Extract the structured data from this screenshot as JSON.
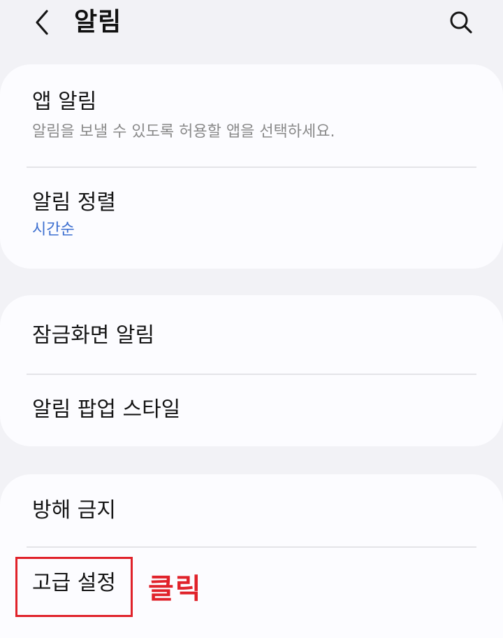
{
  "header": {
    "title": "알림",
    "back_icon": "chevron-left-icon",
    "search_icon": "search-icon"
  },
  "groups": [
    {
      "items": [
        {
          "title": "앱 알림",
          "subtitle": "알림을 보낼 수 있도록 허용할 앱을 선택하세요."
        },
        {
          "title": "알림 정렬",
          "subtitle": "시간순"
        }
      ]
    },
    {
      "items": [
        {
          "title": "잠금화면 알림"
        },
        {
          "title": "알림 팝업 스타일"
        }
      ]
    },
    {
      "items": [
        {
          "title": "방해 금지"
        },
        {
          "title": "고급 설정"
        }
      ]
    }
  ],
  "annotation": {
    "label": "클릭",
    "color": "#e0222a"
  },
  "colors": {
    "background": "#f2f2f6",
    "card": "#fcfcff",
    "accent_value": "#3d6fd0",
    "secondary_text": "#8a8a8a"
  }
}
